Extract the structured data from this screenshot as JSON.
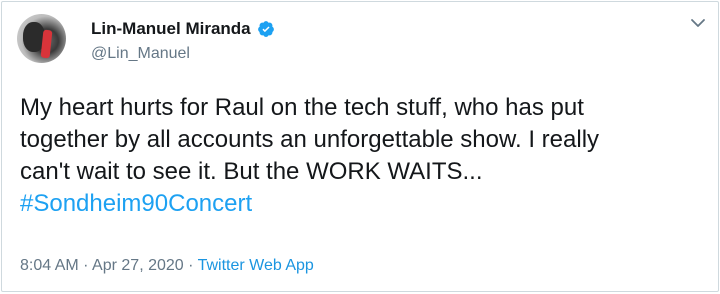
{
  "author": {
    "name": "Lin-Manuel Miranda",
    "handle": "@Lin_Manuel",
    "verified_icon": "verified-badge-icon",
    "avatar": "profile-photo"
  },
  "tweet": {
    "lines": [
      "My heart hurts for Raul on the tech stuff, who has put",
      "together by all accounts an unforgettable show. I really",
      "can't wait to see it.  But the WORK WAITS..."
    ],
    "hashtag": "#Sondheim90Concert"
  },
  "meta": {
    "time": "8:04 AM",
    "separator": "·",
    "date": "Apr 27, 2020",
    "source": "Twitter Web App"
  },
  "menu": {
    "icon": "chevron-down-icon"
  },
  "colors": {
    "text": "#14171a",
    "secondary": "#657786",
    "link": "#1da1f2",
    "verified": "#1da1f2",
    "border": "#cfd9de"
  }
}
